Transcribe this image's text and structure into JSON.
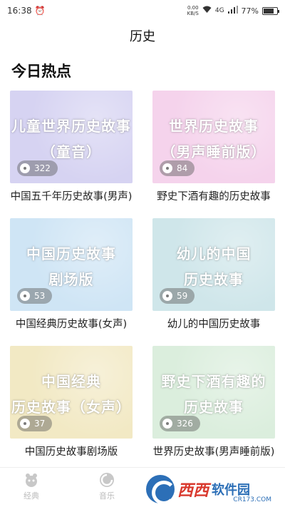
{
  "status_bar": {
    "time": "16:38",
    "net_speed": "0.00",
    "net_unit": "KB/S",
    "signal": "4G",
    "battery": "77%",
    "battery_level": 0.77
  },
  "header": {
    "title": "历史"
  },
  "section": {
    "heading": "今日热点"
  },
  "cards": [
    {
      "art_lines": [
        "儿童世界历史故事",
        "（童音）"
      ],
      "count": "322",
      "title": "中国五千年历史故事(男声)",
      "color": "#d6d3f2"
    },
    {
      "art_lines": [
        "世界历史故事",
        "（男声睡前版）"
      ],
      "count": "84",
      "title": "野史下酒有趣的历史故事",
      "color": "#f5d3ec"
    },
    {
      "art_lines": [
        "中国历史故事",
        "剧场版"
      ],
      "count": "53",
      "title": "中国经典历史故事(女声)",
      "color": "#cfe5f5"
    },
    {
      "art_lines": [
        "幼儿的中国",
        "历史故事"
      ],
      "count": "59",
      "title": "幼儿的中国历史故事",
      "color": "#cfe6ea"
    },
    {
      "art_lines": [
        "中国经典",
        "历史故事（女声）"
      ],
      "count": "37",
      "title": "中国历史故事剧场版",
      "color": "#f2e9c4"
    },
    {
      "art_lines": [
        "野史下酒有趣的",
        "历史故事"
      ],
      "count": "326",
      "title": "世界历史故事(男声睡前版)",
      "color": "#dbeedd"
    }
  ],
  "bottom_nav": {
    "items": [
      {
        "label": "经典",
        "icon": "classic-icon"
      },
      {
        "label": "音乐",
        "icon": "music-icon"
      }
    ]
  },
  "watermark": {
    "text1": "西西",
    "text2": "软件园",
    "url": "CR173.COM"
  }
}
